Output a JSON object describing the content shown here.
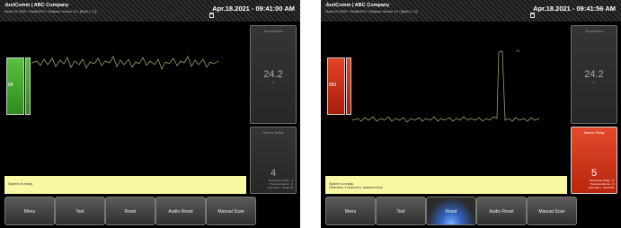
{
  "colors": {
    "green_gauge": "#3ea52a",
    "red_gauge": "#cf3017",
    "status_bar": "#f9f8a3",
    "signal_line": "#b8b07a",
    "alarm_red": "#d83a1c"
  },
  "screens": [
    {
      "brand": "JustComm | ABC Company",
      "subtitle": "Model XC-9000 / SerialNXXX / Software Version 3.0 / [Build 1.7.0]",
      "datetime": "Apr.18.2021 - 09:41:00 AM",
      "gauge_value": "88",
      "gauge_state": "normal",
      "status_lines": [
        "System is ready.",
        ""
      ],
      "temperature": {
        "title": "Temperature",
        "value": "24.2",
        "unit": "°C"
      },
      "alarms": {
        "title": "Alarms Today",
        "value": "4",
        "stats": [
          "Detections Today : 4",
          "Previous Alarms : 0",
          "Last Alarm : 09:30:18"
        ]
      },
      "buttons": [
        "Menu",
        "Test",
        "Reset",
        "Audio Reset",
        "Manual Scan"
      ],
      "pressed_button": ""
    },
    {
      "brand": "JustComm | ABC Company",
      "subtitle": "Model XC-9000 / SerialNXXX / Software Version 3.0 / [Build 1.7.0]",
      "datetime": "Apr.18.2021 - 09:41:56 AM",
      "gauge_value": "850",
      "gauge_state": "alarm",
      "status_lines": [
        "System is ready.",
        "Detection 1 channel 1 alarmed first!"
      ],
      "peak_label": "74",
      "temperature": {
        "title": "Temperature",
        "value": "24.2",
        "unit": "°C"
      },
      "alarms": {
        "title": "Alarms Today",
        "value": "5",
        "stats": [
          "Detections Today : 5",
          "Previous Alarms : 0",
          "Last Alarm : 09:41:56"
        ]
      },
      "buttons": [
        "Menu",
        "Test",
        "Reset",
        "Audio Reset",
        "Manual Scan"
      ],
      "pressed_button": "Reset"
    }
  ]
}
